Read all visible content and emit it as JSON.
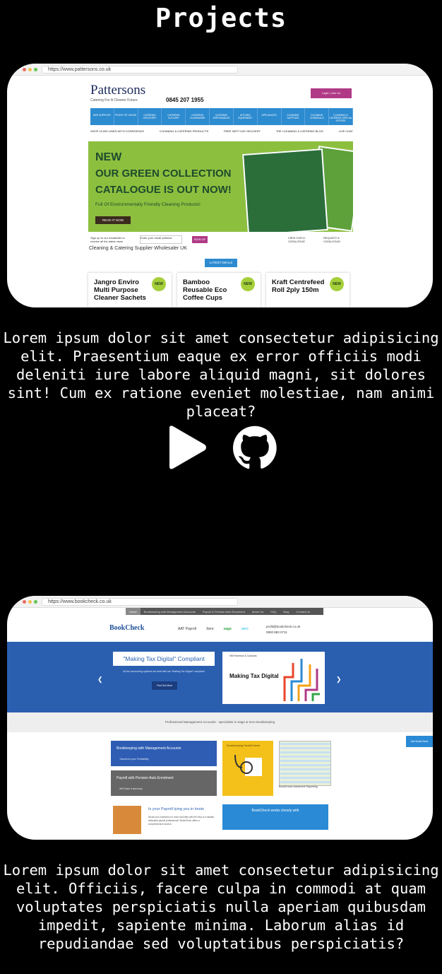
{
  "page": {
    "title": "Projects"
  },
  "projects": [
    {
      "screenshot": {
        "url": "https://www.pattersons.co.uk",
        "brand": "Pattersons",
        "tagline": "Catering For A Cleaner Future",
        "phone": "0845 207 1955",
        "login": "Login | Join Us",
        "search_placeholder": "Search for products, categories...",
        "nav": [
          "Bar Supplies",
          "Front of House",
          "Catering Crockery",
          "Catering Cutlery",
          "Catering Glassware",
          "Catering Disposables",
          "Kitchen Equipment",
          "Appliances",
          "Cleaning Supplies",
          "Cleaning Chemicals",
          "Cleaning & Catering Special Offers"
        ],
        "usps": [
          "SHOP 10,000 LINES WITH CONFIDENCE",
          "CLEANING & CATERING PRODUCTS",
          "FREE NEXT DAY DELIVERY",
          "THE CLEANING & CATERING BLOG",
          "LIVE CHAT"
        ],
        "banner_new": "NEW",
        "banner_line1": "OUR GREEN COLLECTION",
        "banner_line2": "CATALOGUE IS OUT NOW!",
        "banner_sub": "Full Of Environmentally Friendly Cleaning Products!",
        "banner_button": "READ IT NOW",
        "signup_text": "Sign up to our newsletter to receive all the latest news",
        "signup_placeholder": "Enter your email address",
        "signup_button": "SIGN UP",
        "view_catalogue": "VIEW OUR E-CATALOGUE",
        "request_catalogue": "REQUEST A CATALOGUE",
        "tagline2": "Cleaning & Catering Supplier Wholesaler UK",
        "deals_label": "LATEST DEALS",
        "new_badge": "NEW",
        "cards": [
          "Jangro Enviro Multi Purpose Cleaner Sachets",
          "Bamboo Reusable Eco Coffee Cups",
          "Kraft Centrefeed Roll 2ply 150m"
        ]
      },
      "description": "Lorem ipsum dolor sit amet consectetur adipisicing elit. Praesentium eaque ex error officiis modi deleniti iure labore aliquid magni, sit dolores sint! Cum ex ratione eveniet molestiae, nam animi placeat?"
    },
    {
      "screenshot": {
        "url": "https://www.bookcheck.co.uk",
        "nav": [
          "Home",
          "Bookkeeping with Management Accounts",
          "Payroll & Pension Auto Enrolment",
          "About Us",
          "FAQ",
          "Blog",
          "Contact Us"
        ],
        "brand": "BookCheck",
        "partners": [
          "AAT Payroll",
          "Xero",
          "sage",
          "xero"
        ],
        "email": "profit@bookcheck.co.uk",
        "phone": "0800 883 0711",
        "hero_title": "\"Making Tax Digital\" Compliant",
        "hero_sub": "All the accounting systems we deal with are \"Making Tax Digital\" compliant",
        "hero_button": "Find Out More",
        "hmrc_label": "HM Revenue & Customs",
        "hmrc_title": "Making Tax Digital",
        "strip": "Professional Management Accounts - specialists in Sage & Xero Bookkeeping",
        "side_tab": "Ask BookCheck",
        "service1": "Bookkeeping with Management Accounts",
        "service1_sub": "Transform your Profitability",
        "service2": "Payroll with Pension Auto Enrolment",
        "service2_sub": "We'll take it seriously",
        "healthcheck": "Bookkeeping HealthCheck",
        "report": "BookCheck Advanced Reporting",
        "question": "Is your Payroll tying you in knots",
        "question_sub": "Would your business run more smoothly with the help of a reliable, dedicated payroll professional? BookCheck offers a comprehensive service.",
        "works_with": "BookCheck works closely with"
      },
      "description": "Lorem ipsum dolor sit amet consectetur adipisicing elit. Officiis, facere culpa in commodi at quam voluptates perspiciatis nulla aperiam quibusdam impedit, sapiente minima. Laborum alias id repudiandae sed voluptatibus perspiciatis?"
    }
  ],
  "icons": {
    "play": "play-icon",
    "github": "github-icon"
  },
  "colors": {
    "background": "#000000",
    "text": "#ffffff",
    "pattersons_nav": "#2d8bd0",
    "pattersons_banner": "#8dbf3f",
    "bookcheck_hero": "#2a5fb0"
  }
}
